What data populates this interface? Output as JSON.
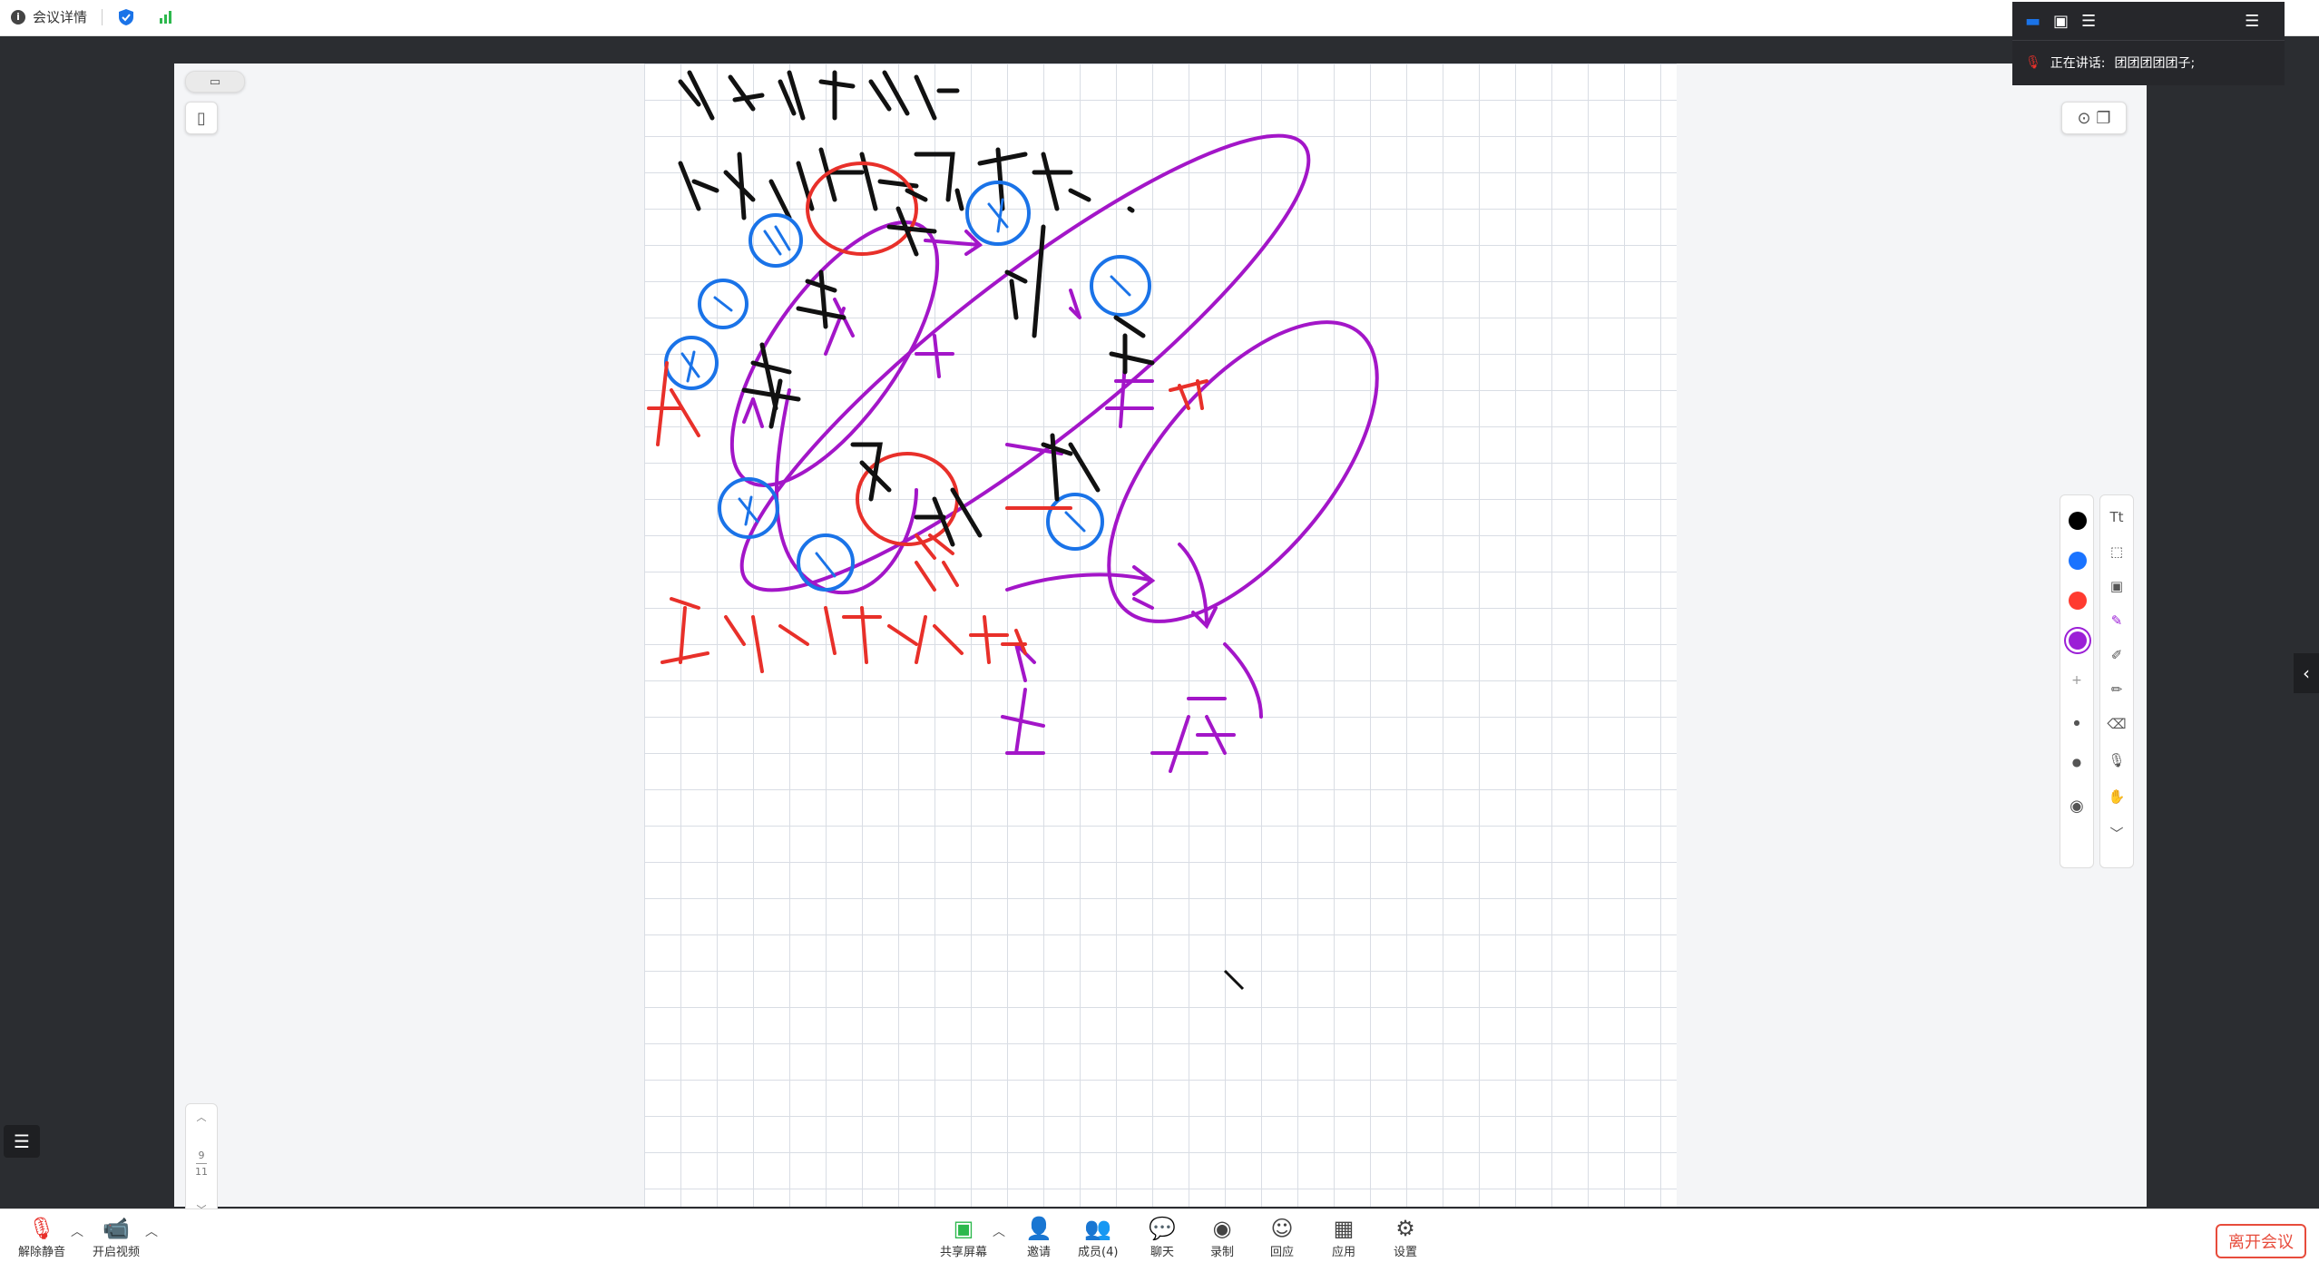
{
  "topbar": {
    "meeting_info": "会议详情"
  },
  "speaker": {
    "label": "正在讲话:",
    "name": "团团团团团子;"
  },
  "pager": {
    "current": "9",
    "total": "11"
  },
  "whiteboard": {
    "colors": [
      "#000000",
      "#1a73ff",
      "#ff3b30",
      "#9b1fd6"
    ],
    "ink_colors": {
      "black": "#111111",
      "blue": "#1a73e8",
      "red": "#e8302a",
      "purple": "#a316c8"
    }
  },
  "bottombar": {
    "unmute": "解除静音",
    "start_video": "开启视频",
    "share_screen": "共享屏幕",
    "invite": "邀请",
    "members": "成员(4)",
    "chat": "聊天",
    "record": "录制",
    "reaction": "回应",
    "apps": "应用",
    "settings": "设置",
    "leave": "离开会议"
  }
}
